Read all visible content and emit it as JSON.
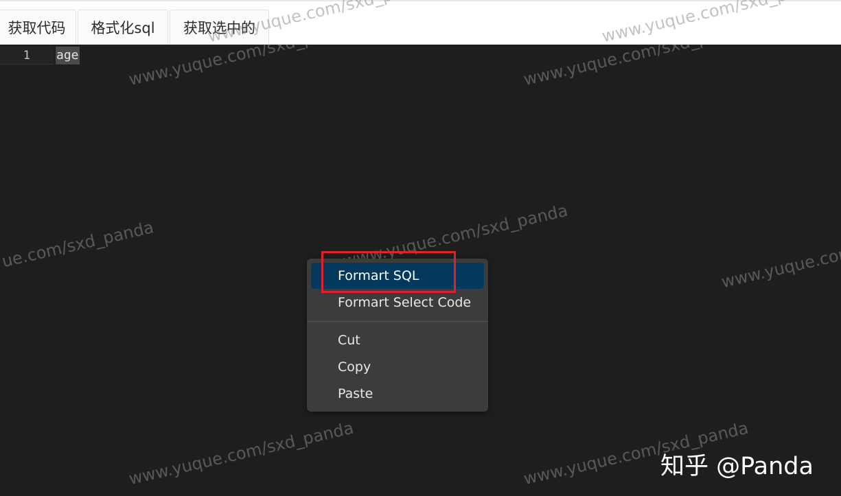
{
  "toolbar": {
    "buttons": [
      {
        "label": "获取代码"
      },
      {
        "label": "格式化sql"
      },
      {
        "label": "获取选中的"
      }
    ]
  },
  "editor": {
    "lines": [
      {
        "number": "1",
        "text": "age"
      }
    ]
  },
  "context_menu": {
    "items": [
      {
        "label": "Formart SQL",
        "highlighted": true
      },
      {
        "label": "Formart Select Code"
      },
      {
        "label": "Cut"
      },
      {
        "label": "Copy"
      },
      {
        "label": "Paste"
      }
    ]
  },
  "watermark": {
    "text": "www.yuque.com/sxd_panda",
    "partial_left": "ue.com/sxd_panda",
    "partial_right": "www.yuque.com"
  },
  "credit": "知乎 @Panda",
  "colors": {
    "editor_bg": "#1e1e1e",
    "menu_bg": "#3c3c3c",
    "menu_active": "#04395e",
    "highlight_border": "#e0202a"
  }
}
